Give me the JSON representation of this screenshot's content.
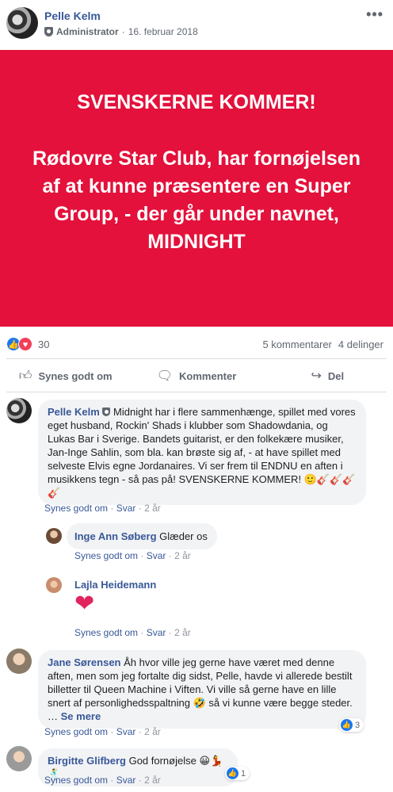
{
  "post": {
    "author": "Pelle Kelm",
    "role": "Administrator",
    "date": "16. februar 2018",
    "more": "•••"
  },
  "banner": {
    "line1": "SVENSKERNE KOMMER!",
    "line2": "Rødovre Star Club, har fornøjelsen af at kunne præsentere en Super Group, - der går under navnet, MIDNIGHT",
    "color": "#e3113b"
  },
  "reactions": {
    "count": "30",
    "comments": "5 kommentarer",
    "shares": "4 delinger"
  },
  "actions": {
    "like": "Synes godt om",
    "comment": "Kommenter",
    "share": "Del"
  },
  "comments": [
    {
      "name": "Pelle Kelm",
      "text": "Midnight har i flere sammenhænge, spillet med vores eget husband, Rockin' Shads i klubber som Shadowdania, og Lukas Bar i Sverige. Bandets guitarist, er den folkekære musiker, Jan-Inge Sahlin, som bla. kan brøste sig af, - at have spillet med selveste Elvis egne Jordanaires. Vi ser frem til ENDNU en aften i musikkens tegn - så pas på! SVENSKERNE KOMMER! 🙂🎸🎸🎸🎸",
      "like": "Synes godt om",
      "reply": "Svar",
      "time": "2 år"
    },
    {
      "name": "Inge Ann Søberg",
      "text": "Glæder os",
      "like": "Synes godt om",
      "reply": "Svar",
      "time": "2 år"
    },
    {
      "name": "Lajla Heidemann",
      "text": "❤",
      "like": "Synes godt om",
      "reply": "Svar",
      "time": "2 år"
    },
    {
      "name": "Jane Sørensen",
      "text": "Åh hvor ville jeg gerne have været med denne aften, men som jeg fortalte dig sidst, Pelle, havde vi allerede bestilt billetter til Queen Machine i Viften. Vi ville så gerne have en lille snert af personlighedsspaltning 🤣 så vi kunne være begge steder. …",
      "see_more": "Se mere",
      "like": "Synes godt om",
      "reply": "Svar",
      "time": "2 år",
      "reactions": "3"
    },
    {
      "name": "Birgitte Glifberg",
      "text": "God fornøjelse 😀💃🕺",
      "like": "Synes godt om",
      "reply": "Svar",
      "time": "2 år",
      "reactions": "1"
    }
  ]
}
